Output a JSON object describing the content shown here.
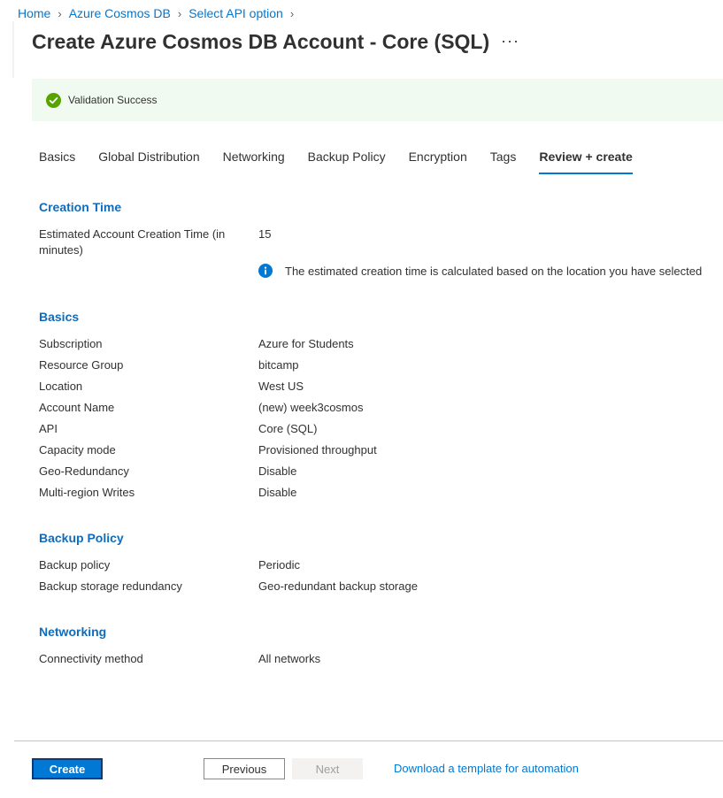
{
  "breadcrumb": {
    "items": [
      "Home",
      "Azure Cosmos DB",
      "Select API option"
    ]
  },
  "page": {
    "title": "Create Azure Cosmos DB Account - Core (SQL)",
    "more_label": "···"
  },
  "banner": {
    "message": "Validation Success",
    "icon": "success-check-icon",
    "bg": "#f1faf0",
    "icon_color": "#57a300"
  },
  "tabs": [
    "Basics",
    "Global Distribution",
    "Networking",
    "Backup Policy",
    "Encryption",
    "Tags",
    "Review + create"
  ],
  "active_tab": "Review + create",
  "creation": {
    "title": "Creation Time",
    "label_line1": "Estimated Account Creation Time (in",
    "label_line2": "minutes)",
    "value": "15",
    "info_icon": "info-icon",
    "info_text": "The estimated creation time is calculated based on the location you have selected"
  },
  "basics": {
    "title": "Basics",
    "rows": [
      {
        "label": "Subscription",
        "value": "Azure for Students"
      },
      {
        "label": "Resource Group",
        "value": "bitcamp"
      },
      {
        "label": "Location",
        "value": "West US"
      },
      {
        "label": "Account Name",
        "value": "(new) week3cosmos"
      },
      {
        "label": "API",
        "value": "Core (SQL)"
      },
      {
        "label": "Capacity mode",
        "value": "Provisioned throughput"
      },
      {
        "label": "Geo-Redundancy",
        "value": "Disable"
      },
      {
        "label": "Multi-region Writes",
        "value": "Disable"
      }
    ]
  },
  "backup": {
    "title": "Backup Policy",
    "rows": [
      {
        "label": "Backup policy",
        "value": "Periodic"
      },
      {
        "label": "Backup storage redundancy",
        "value": "Geo-redundant backup storage"
      }
    ]
  },
  "networking": {
    "title": "Networking",
    "rows": [
      {
        "label": "Connectivity method",
        "value": "All networks"
      }
    ]
  },
  "footer": {
    "create_label": "Create",
    "previous_label": "Previous",
    "next_label": "Next",
    "download_label": "Download a template for automation"
  },
  "colors": {
    "accent": "#0078d4",
    "section_heading": "#0f6cbd"
  }
}
